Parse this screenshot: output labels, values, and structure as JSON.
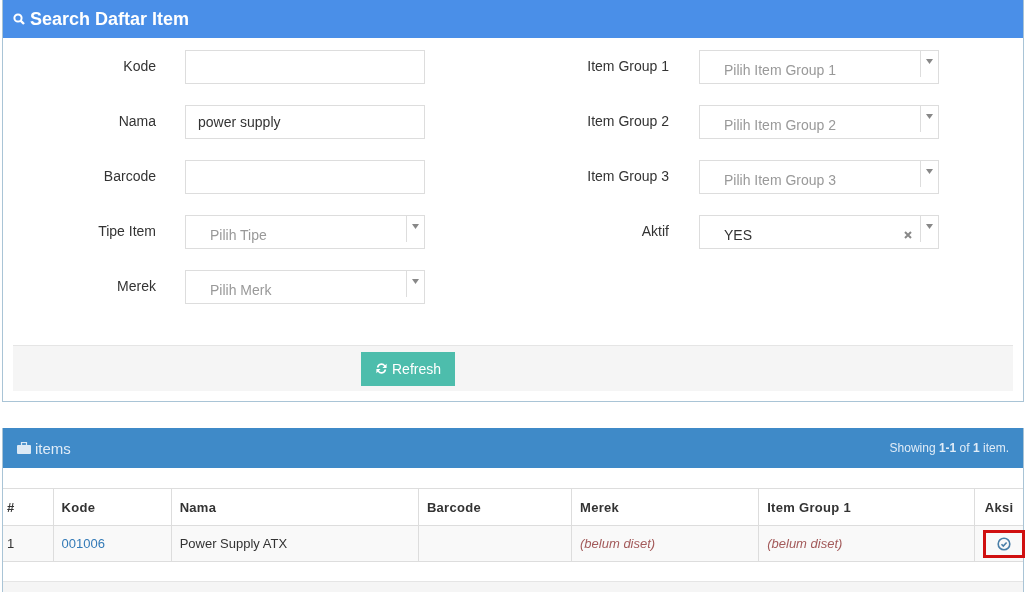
{
  "search_panel": {
    "title": "Search Daftar Item",
    "left_fields": [
      {
        "label": "Kode",
        "kind": "text"
      },
      {
        "label": "Nama",
        "kind": "text",
        "value": "power supply"
      },
      {
        "label": "Barcode",
        "kind": "text"
      },
      {
        "label": "Tipe Item",
        "kind": "select",
        "placeholder": "Pilih Tipe",
        "clearable": false
      },
      {
        "label": "Merek",
        "kind": "select",
        "placeholder": "Pilih Merk",
        "clearable": false
      }
    ],
    "right_fields": [
      {
        "label": "Item Group 1",
        "kind": "select",
        "placeholder": "Pilih Item Group 1",
        "clearable": false
      },
      {
        "label": "Item Group 2",
        "kind": "select",
        "placeholder": "Pilih Item Group 2",
        "clearable": false
      },
      {
        "label": "Item Group 3",
        "kind": "select",
        "placeholder": "Pilih Item Group 3",
        "clearable": false
      },
      {
        "label": "Aktif",
        "kind": "select",
        "value": "YES",
        "clearable": true
      }
    ],
    "refresh_button": "Refresh"
  },
  "items_panel": {
    "title": "items",
    "summary": "Showing **1-1** of **1** item.",
    "table": {
      "columns": [
        "#",
        "Kode",
        "Nama",
        "Barcode",
        "Merek",
        "Item Group 1",
        "Aksi"
      ],
      "rows": [
        {
          "cells": [
            {
              "kind": "plain",
              "text": "1"
            },
            {
              "kind": "link",
              "text": "001006"
            },
            {
              "kind": "plain",
              "text": "Power Supply ATX"
            },
            {
              "kind": "empty"
            },
            {
              "kind": "unset",
              "text": "(belum diset)"
            },
            {
              "kind": "unset",
              "text": "(belum diset)"
            },
            {
              "kind": "action",
              "highlighted": true
            }
          ]
        }
      ]
    }
  }
}
